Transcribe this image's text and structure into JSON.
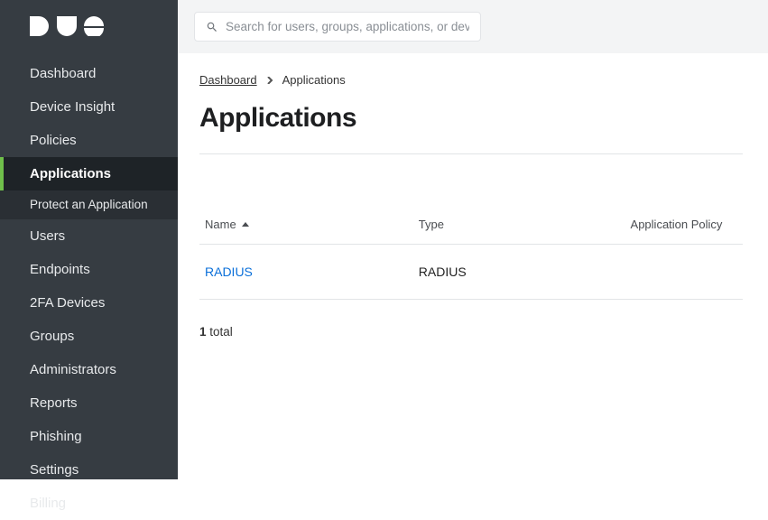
{
  "sidebar": {
    "items": [
      {
        "label": "Dashboard"
      },
      {
        "label": "Device Insight"
      },
      {
        "label": "Policies"
      },
      {
        "label": "Applications",
        "active": true
      },
      {
        "label": "Users"
      },
      {
        "label": "Endpoints"
      },
      {
        "label": "2FA Devices"
      },
      {
        "label": "Groups"
      },
      {
        "label": "Administrators"
      },
      {
        "label": "Reports"
      },
      {
        "label": "Phishing"
      },
      {
        "label": "Settings"
      },
      {
        "label": "Billing"
      }
    ],
    "sub_item": {
      "label": "Protect an Application"
    }
  },
  "search": {
    "placeholder": "Search for users, groups, applications, or devices"
  },
  "breadcrumb": {
    "root": "Dashboard",
    "current": "Applications"
  },
  "page": {
    "title": "Applications"
  },
  "table": {
    "columns": {
      "name": "Name",
      "type": "Type",
      "policy": "Application Policy"
    },
    "rows": [
      {
        "name": "RADIUS",
        "type": "RADIUS",
        "policy": ""
      }
    ]
  },
  "total": {
    "count": "1",
    "suffix": " total"
  }
}
